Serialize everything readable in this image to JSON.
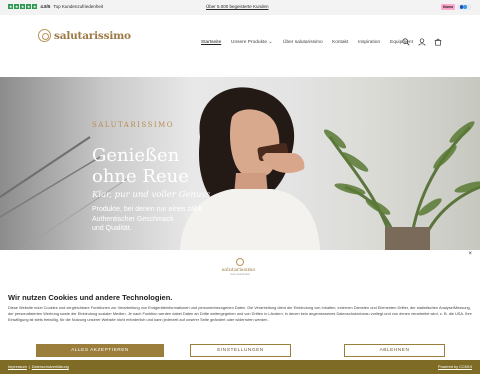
{
  "topbar": {
    "rating_score": "4.8/5",
    "rating_label": "Top Kundenzufriedenheit",
    "center_link": "Über 5.000 begeisterte Kunden",
    "payment_badges": [
      "Klarna",
      "PayPal"
    ]
  },
  "header": {
    "logo_text": "salutarissimo",
    "nav": [
      "Startseite",
      "Unsere Produkte",
      "Über salutarissimo",
      "Kontakt",
      "Inspiration",
      "Equipment"
    ],
    "active_nav": "Startseite",
    "icons": [
      "search-icon",
      "account-icon",
      "cart-icon"
    ]
  },
  "hero": {
    "brand": "SALUTARISSIMO",
    "title_line1": "Genießen",
    "title_line2": "ohne Reue",
    "subtitle": "Klar, pur und voller Genuss",
    "body_line1": "Produkte, bei denen nur eines zählt:",
    "body_line2": "Authentischer Geschmack",
    "body_line3": "und Qualität."
  },
  "cookie": {
    "close": "×",
    "logo_text": "salutarissimo",
    "logo_small": "Gute Geschmack",
    "title": "Wir nutzen Cookies und andere Technologien.",
    "text": "Diese Website nutzt Cookies und vergleichbare Funktionen zur Verarbeitung von Endgeräteinformationen und personenbezogenen Daten. Die Verarbeitung dient der Einbindung von Inhalten, externen Diensten und Elementen Dritter, der statistischen Analyse/Messung, der personalisierten Werbung sowie der Einbindung sozialer Medien. Je nach Funktion werden dabei Daten an Dritte weitergegeben und von Dritten in Ländern, in denen kein angemessenes Datenschutzniveau vorliegt und von denen verarbeitet wird, z. B. die USA. Ihre Einwilligung ist stets freiwillig, für die Nutzung unserer Website nicht erforderlich und kann jederzeit auf unserer Seite geändert oder widerrufen werden.",
    "accept_label": "ALLES AKZEPTIEREN",
    "settings_label": "EINSTELLUNGEN",
    "decline_label": "ABLEHNEN"
  },
  "footer": {
    "imprint": "Impressum",
    "separator": "|",
    "privacy": "Datenschutzerklärung",
    "powered": "Powered by CCM19"
  },
  "colors": {
    "gold": "#9b7e3b",
    "bottom_bar": "#7e6b25",
    "trustpilot_green": "#2e9a52"
  }
}
